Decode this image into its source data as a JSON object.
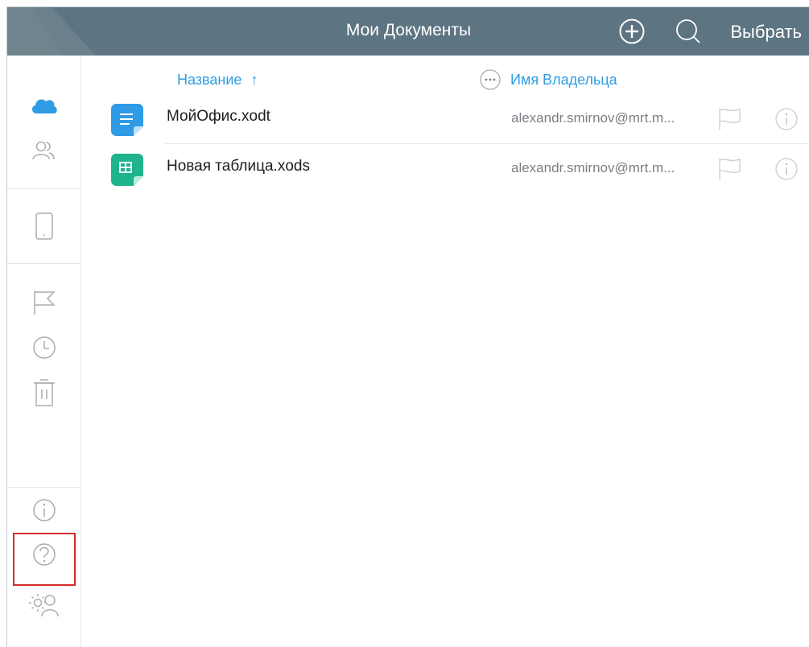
{
  "header": {
    "title": "Мои Документы",
    "select_label": "Выбрать",
    "add_icon": "plus-circle-icon",
    "search_icon": "search-icon"
  },
  "sidebar": {
    "groups": [
      [
        "cloud-icon",
        "users-icon"
      ],
      [
        "device-icon"
      ],
      [
        "flag-icon",
        "clock-icon",
        "trash-icon"
      ],
      [
        "info-icon",
        "help-icon",
        "user-settings-icon"
      ]
    ],
    "highlighted": "user-settings-icon"
  },
  "columns": {
    "name_label": "Название",
    "sort_arrow": "↑",
    "owner_label": "Имя Владельца",
    "more_icon": "more-icon"
  },
  "files": [
    {
      "name": "МойОфис.xodt",
      "owner": "alexandr.smirnov@mrt.m...",
      "type": "text-document",
      "icon": "text-document-icon"
    },
    {
      "name": "Новая таблица.xods",
      "owner": "alexandr.smirnov@mrt.m...",
      "type": "spreadsheet",
      "icon": "spreadsheet-icon"
    }
  ],
  "colors": {
    "header_bg": "#5d7482",
    "accent": "#2e9de3",
    "text_doc": "#2f9be6",
    "spreadsheet": "#1fb48c",
    "highlight": "#d32a2a"
  }
}
